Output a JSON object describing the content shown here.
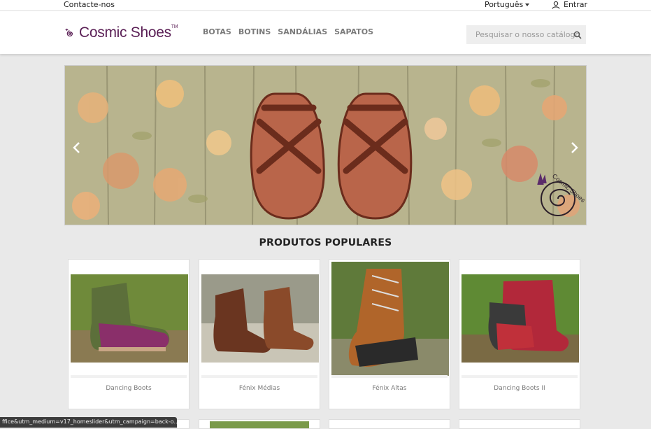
{
  "topbar": {
    "contact_label": "Contacte-nos",
    "language_label": "Português",
    "login_label": "Entrar"
  },
  "header": {
    "logo_text": "Cosmic Shoes",
    "logo_tm": "TM",
    "nav": [
      "BOTAS",
      "BOTINS",
      "SANDÁLIAS",
      "SAPATOS"
    ],
    "search_placeholder": "Pesquisar o nosso catálogo"
  },
  "slider": {
    "watermark_text": "Cosmic Shoes"
  },
  "main": {
    "section_title": "PRODUTOS POPULARES",
    "products": [
      {
        "name": "Dancing Boots"
      },
      {
        "name": "Fénix Médias"
      },
      {
        "name": "Fénix Altas"
      },
      {
        "name": "Dancing Boots II"
      }
    ]
  },
  "statusbar": {
    "url_text": "ffice&utm_medium=v17_homeslider&utm_campaign=back-o..."
  },
  "colors": {
    "brand": "#5a1f55",
    "nav_text": "#7a7a7a",
    "background": "#e9e9e9"
  }
}
